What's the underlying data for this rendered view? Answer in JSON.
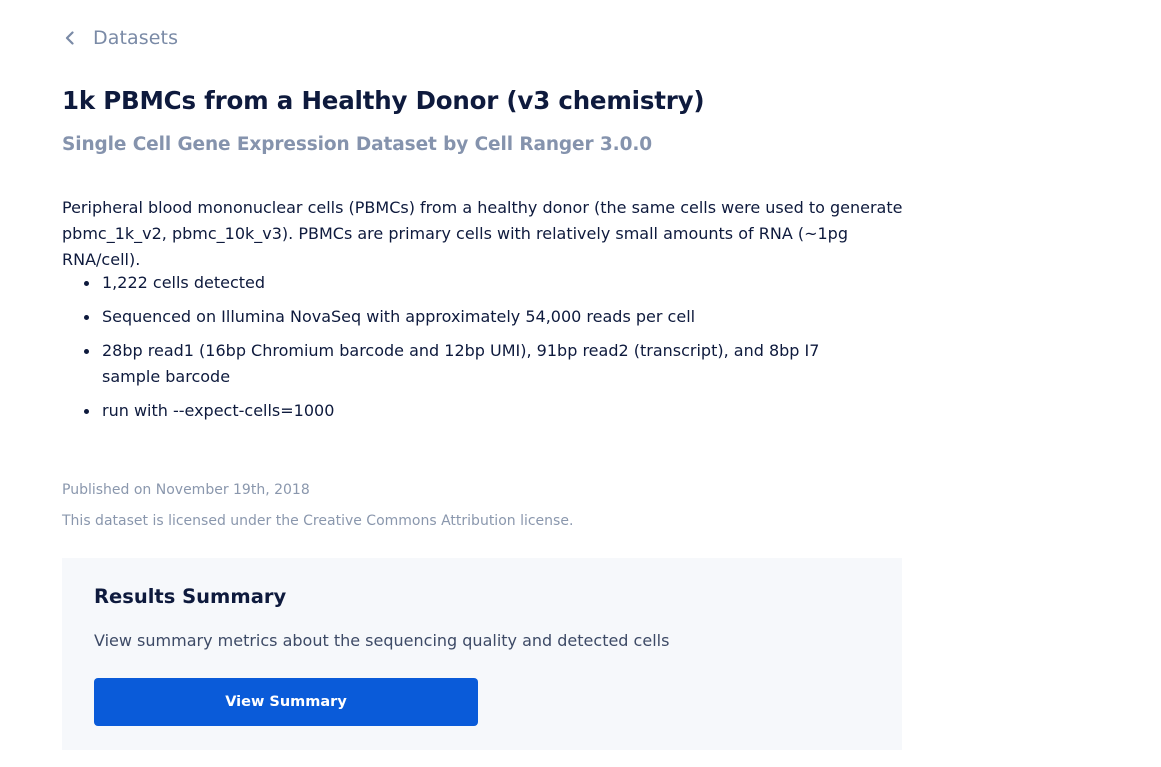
{
  "breadcrumb": {
    "back_label": "Datasets",
    "icon": "chevron-left-icon"
  },
  "header": {
    "title": "1k PBMCs from a Healthy Donor (v3 chemistry)",
    "subtitle": "Single Cell Gene Expression Dataset by Cell Ranger 3.0.0"
  },
  "main": {
    "description": "Peripheral blood mononuclear cells (PBMCs) from a healthy donor (the same cells were used to generate pbmc_1k_v2, pbmc_10k_v3). PBMCs are primary cells with relatively small amounts of RNA (~1pg RNA/cell).",
    "bullets": [
      "1,222 cells detected",
      "Sequenced on Illumina NovaSeq with approximately 54,000 reads per cell",
      "28bp read1 (16bp Chromium barcode and 12bp UMI), 91bp read2 (transcript), and 8bp I7 sample barcode",
      "run with --expect-cells=1000"
    ],
    "published": "Published on November 19th, 2018",
    "license": "This dataset is licensed under the Creative Commons Attribution license."
  },
  "results_summary": {
    "title": "Results Summary",
    "text": "View summary metrics about the sequencing quality and detected cells",
    "button_label": "View Summary"
  },
  "colors": {
    "heading": "#0e1a3d",
    "muted": "#8593ad",
    "card_background": "#f6f8fb",
    "primary_button": "#0a5bd9"
  }
}
